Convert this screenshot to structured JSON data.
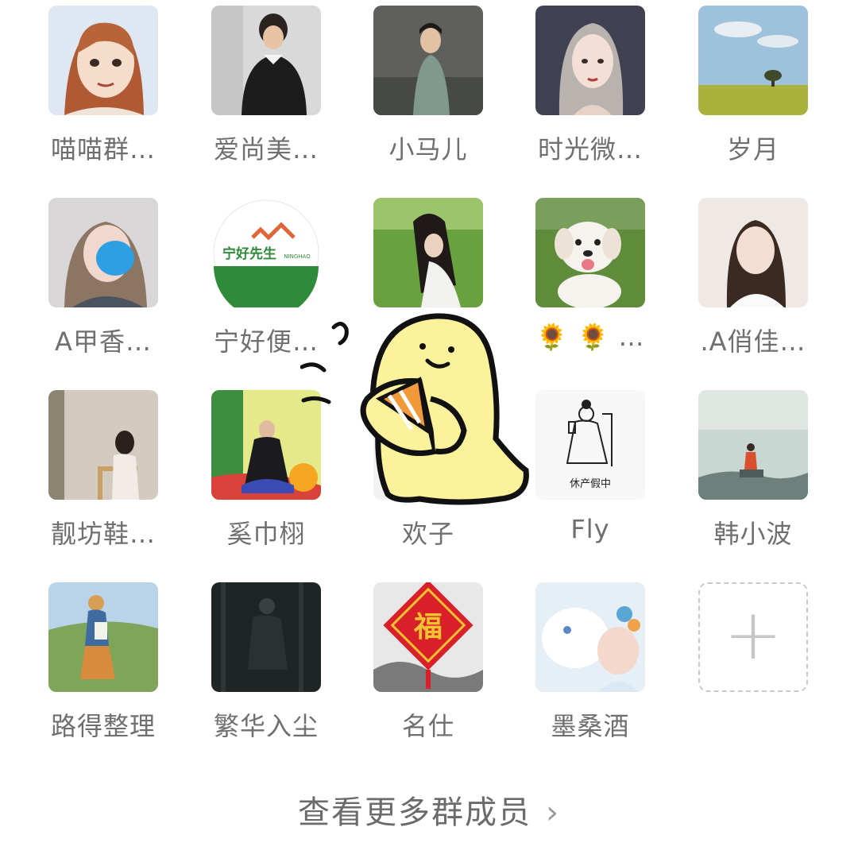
{
  "members": [
    {
      "name": "喵喵群…",
      "avatar": "cartoon-girl"
    },
    {
      "name": "爱尚美…",
      "avatar": "woman-black-sweater"
    },
    {
      "name": "小马儿",
      "avatar": "woman-green-dress"
    },
    {
      "name": "时光微…",
      "avatar": "illustrated-woman"
    },
    {
      "name": "岁月",
      "avatar": "landscape-tree"
    },
    {
      "name": "A甲香…",
      "avatar": "girl-blue-mask"
    },
    {
      "name": "宁好便…",
      "avatar": "ninghao-logo",
      "logo_text": "宁好先生",
      "logo_sub": "NINGHAO"
    },
    {
      "name": "",
      "avatar": "woman-grass"
    },
    {
      "name": "🌻 🌻 …",
      "avatar": "white-puppy"
    },
    {
      "name": ".A俏佳…",
      "avatar": "woman-selfie"
    },
    {
      "name": "靓坊鞋…",
      "avatar": "woman-chair"
    },
    {
      "name": "奚巾栩",
      "avatar": "woman-flowers"
    },
    {
      "name": "欢子",
      "avatar": "hidden"
    },
    {
      "name": "Fly",
      "avatar": "sketch-maternity",
      "caption": "休产假中"
    },
    {
      "name": "韩小波",
      "avatar": "seaside-figure"
    },
    {
      "name": "路得整理",
      "avatar": "illustrated-walker"
    },
    {
      "name": "繁华入尘",
      "avatar": "dark-silhouette"
    },
    {
      "name": "名仕",
      "avatar": "fu-decoration",
      "fu_char": "福"
    },
    {
      "name": "墨桑酒",
      "avatar": "white-cat-girl"
    }
  ],
  "add_button": {
    "icon": "plus-icon",
    "label": "+"
  },
  "view_more": {
    "label": "查看更多群成员",
    "icon": "chevron-right-icon",
    "chevron": "›"
  },
  "sticker": {
    "icon": "yellow-blob-sticker"
  }
}
